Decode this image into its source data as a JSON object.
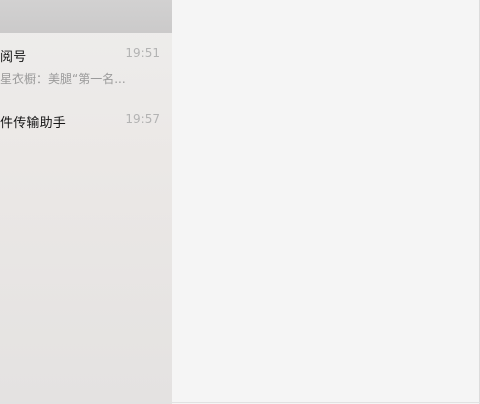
{
  "chat_list": {
    "items": [
      {
        "name": "阅号",
        "time": "19:51",
        "preview": "星衣橱：美腿“第一名..."
      },
      {
        "name": "件传输助手",
        "time": "19:57",
        "preview": ""
      }
    ]
  },
  "colors": {
    "panel_bg": "#ebe8e6",
    "header_bg": "#cecdcd",
    "content_bg": "#f5f5f5",
    "time_text": "#b3b3b3",
    "preview_text": "#9a9a9a"
  }
}
